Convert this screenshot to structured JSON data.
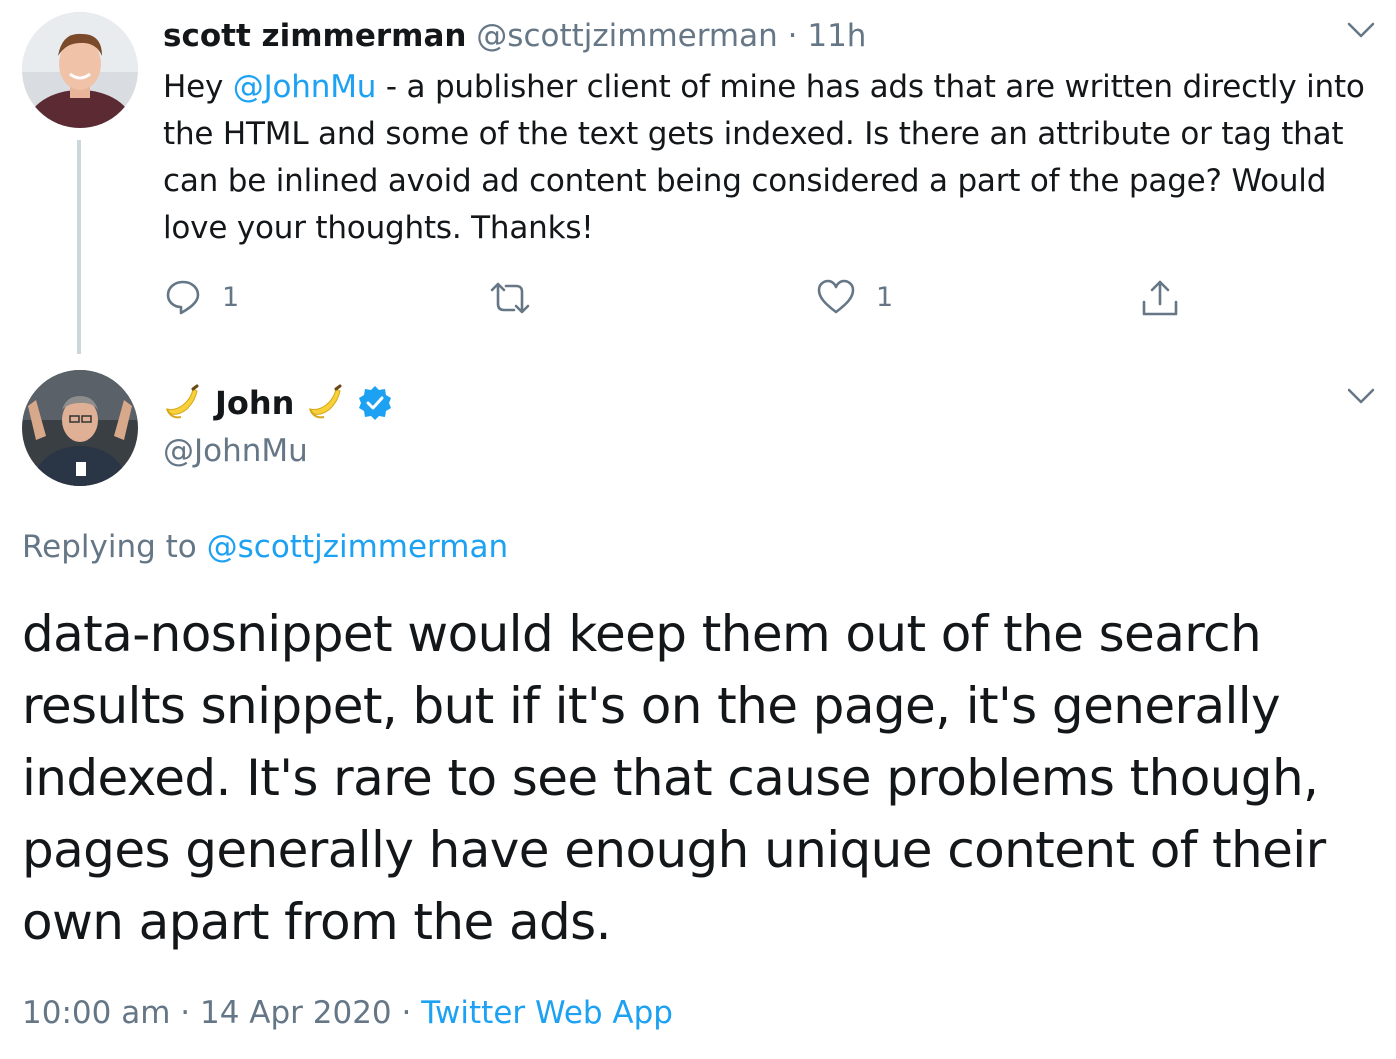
{
  "parent_tweet": {
    "display_name": "scott zimmerman",
    "handle": "@scottjzimmerman",
    "separator": "·",
    "time": "11h",
    "text_prefix": "Hey ",
    "mention": "@JohnMu",
    "text_rest": " - a publisher client of mine has ads that are written directly into the HTML and some of the text gets indexed. Is there an attribute or tag that can be inlined avoid ad content being considered a part of the page? Would love your thoughts. Thanks!",
    "actions": {
      "reply_icon": "reply-bubble-icon",
      "reply_count": "1",
      "retweet_icon": "retweet-icon",
      "like_icon": "heart-icon",
      "like_count": "1",
      "share_icon": "share-upload-icon"
    }
  },
  "main_tweet": {
    "display_name": "John",
    "name_emoji": "banana-emoji",
    "verified_icon": "verified-badge-icon",
    "handle": "@JohnMu",
    "replying_label": "Replying to ",
    "replying_to": "@scottjzimmerman",
    "text": "data-nosnippet would keep them out of the search results snippet, but if it's on the page, it's generally indexed. It's rare to see that cause problems though, pages generally have enough unique content of their own apart from the ads.",
    "time": "10:00 am",
    "separator": "·",
    "date": "14 Apr 2020",
    "source": "Twitter Web App"
  },
  "icons": {
    "menu_chevron": "chevron-down-icon"
  },
  "colors": {
    "text": "#14171a",
    "muted": "#657786",
    "link": "#1da1f2",
    "thread_line": "#ccd6dd",
    "verified": "#1da1f2"
  }
}
